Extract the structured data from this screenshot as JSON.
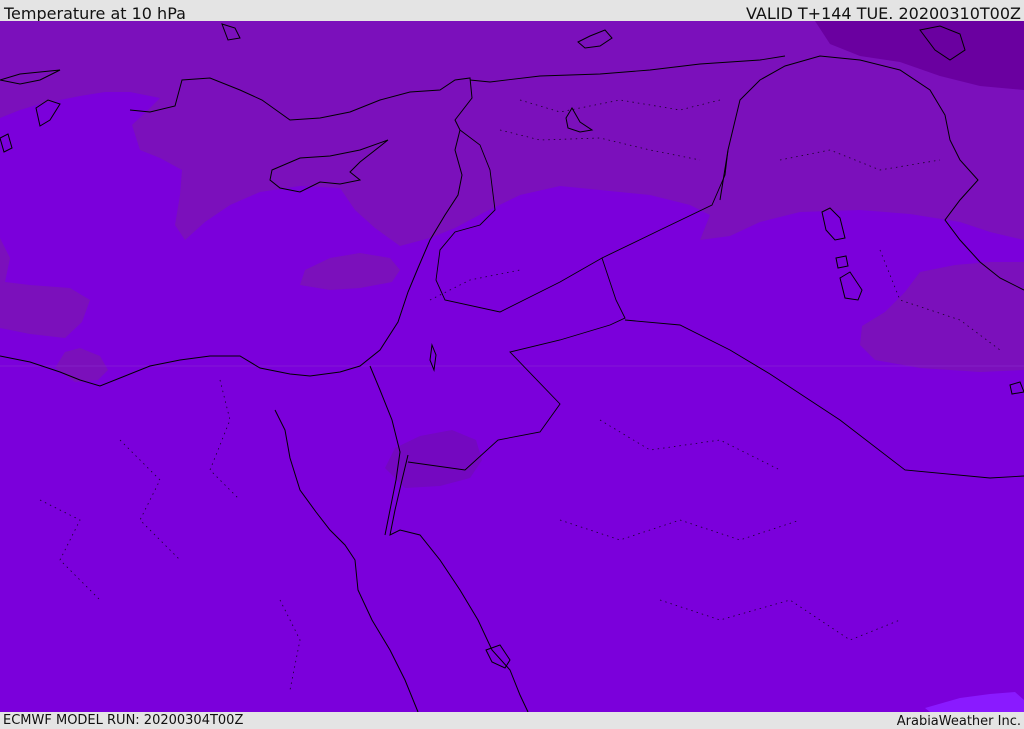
{
  "header": {
    "title": "Temperature at 10 hPa",
    "valid_time": "VALID T+144 TUE. 20200310T00Z"
  },
  "footer": {
    "model_run": "ECMWF MODEL RUN: 20200304T00Z",
    "credit": "ArabiaWeather Inc."
  },
  "map": {
    "base_fill": "#7b00db",
    "colors": {
      "warm_band": "#7b10bb",
      "cold_core": "#6a00a0",
      "warm_spot": "#7408c0",
      "light_patch": "#8a1aff",
      "coastline": "#000000"
    }
  }
}
